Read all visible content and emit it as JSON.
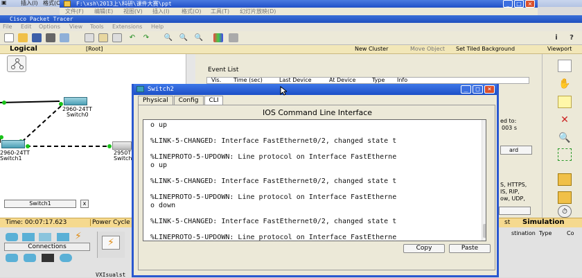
{
  "ppt": {
    "left_menu": [
      "插入(I)",
      "格式(O)"
    ],
    "window_title": "F:\\xsh\\2013上\\科研\\课件大赛\\ppt",
    "menu_items": [
      "文件(F)",
      "编辑(E)",
      "视图(V)",
      "插入(I)",
      "格式(O)",
      "工具(T)",
      "幻灯片放映(D)"
    ]
  },
  "packet_tracer": {
    "title": "Cisco Packet Tracer",
    "menu": [
      "File",
      "Edit",
      "Options",
      "View",
      "Tools",
      "Extensions",
      "Help"
    ],
    "toolbar_icons": [
      "new-icon",
      "open-icon",
      "save-icon",
      "print-icon",
      "wizard-icon",
      "copy-icon",
      "paste-icon",
      "undo-icon",
      "redo-icon",
      "zoom-in-icon",
      "zoom-reset-icon",
      "zoom-out-icon",
      "palette-icon",
      "device-icon",
      "info-icon",
      "help-icon"
    ]
  },
  "nav_bar": {
    "logical": "Logical",
    "root": "[Root]",
    "new_cluster": "New Cluster",
    "move_object": "Move Object",
    "set_tiled_background": "Set Tiled Background",
    "viewport": "Viewport"
  },
  "topology": {
    "devices": [
      {
        "model": "2960-24TT",
        "name": "Switch0"
      },
      {
        "model": "2960-24TT",
        "name": "Switch1"
      },
      {
        "model": "2950T",
        "name": "Switch"
      }
    ],
    "device_name_box": "Switch1"
  },
  "event_list": {
    "label": "Event List",
    "columns": [
      "Vis.",
      "Time (sec)",
      "Last Device",
      "At Device",
      "Type",
      "Info"
    ],
    "side_text": [
      "ed to:",
      "003 s",
      "ard",
      "S, HTTPS,",
      "IS, RIP,",
      "ow, UDP,"
    ]
  },
  "status_bar": {
    "time": "Time: 00:07:17.623",
    "power_cycle": "Power Cycle",
    "simulation": "Simulation",
    "realtime_fragment": "st"
  },
  "bottom": {
    "connections_label": "Connections",
    "columns": [
      "stination",
      "Type",
      "Co"
    ],
    "taskbar_text": "VXIsualst"
  },
  "dialog": {
    "title": "Switch2",
    "tabs": [
      "Physical",
      "Config",
      "CLI"
    ],
    "active_tab": "CLI",
    "heading": "IOS Command Line Interface",
    "cli_output": "o up\n\n%LINK-5-CHANGED: Interface FastEthernet0/2, changed state t\n\n%LINEPROTO-5-UPDOWN: Line protocol on Interface FastEtherne\no up\n\n%LINK-5-CHANGED: Interface FastEthernet0/2, changed state t\n\n%LINEPROTO-5-UPDOWN: Line protocol on Interface FastEtherne\no down\n\n%LINK-5-CHANGED: Interface FastEthernet0/2, changed state t\n\n%LINEPROTO-5-UPDOWN: Line protocol on Interface FastEtherne\no up",
    "copy_label": "Copy",
    "paste_label": "Paste"
  },
  "colors": {
    "xp_title_blue": "#2150c8",
    "workspace_bg": "#ffffff",
    "status_yellow": "#f5d98f",
    "link_green": "#19c219"
  }
}
